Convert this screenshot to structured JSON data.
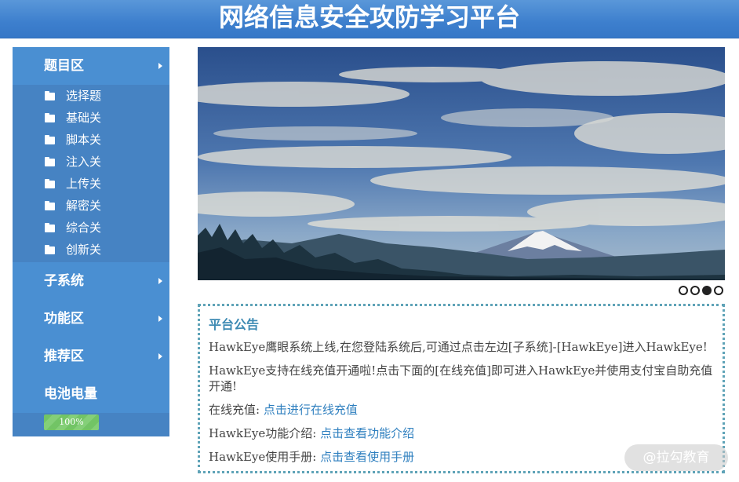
{
  "header": {
    "title": "网络信息安全攻防学习平台"
  },
  "sidebar": {
    "sections": [
      {
        "label": "题目区"
      },
      {
        "label": "子系统"
      },
      {
        "label": "功能区"
      },
      {
        "label": "推荐区"
      },
      {
        "label": "电池电量"
      }
    ],
    "sub_items": [
      {
        "label": "选择题"
      },
      {
        "label": "基础关"
      },
      {
        "label": "脚本关"
      },
      {
        "label": "注入关"
      },
      {
        "label": "上传关"
      },
      {
        "label": "解密关"
      },
      {
        "label": "综合关"
      },
      {
        "label": "创新关"
      }
    ],
    "battery": {
      "text": "100%",
      "level": 1.0
    }
  },
  "carousel": {
    "slide_count": 4,
    "active_index": 2
  },
  "notice": {
    "title": "平台公告",
    "line1": "HawkEye鹰眼系统上线,在您登陆系统后,可通过点击左边[子系统]-[HawkEye]进入HawkEye!",
    "line2": "HawkEye支持在线充值开通啦!点击下面的[在线充值]即可进入HawkEye并使用支付宝自助充值开通!",
    "line3_prefix": "在线充值: ",
    "line3_link": "点击进行在线充值",
    "line4_prefix": "HawkEye功能介绍: ",
    "line4_link": "点击查看功能介绍",
    "line5_prefix": "HawkEye使用手册: ",
    "line5_link": "点击查看使用手册"
  },
  "watermark": {
    "text": "@拉勾教育"
  },
  "colors": {
    "header": "#3d7fcd",
    "sidebar_section": "#4a8fd2",
    "sidebar_sub": "#4683c3",
    "link": "#2e7fbf",
    "notice_border": "#5fa3b7",
    "battery": "#72c465"
  }
}
